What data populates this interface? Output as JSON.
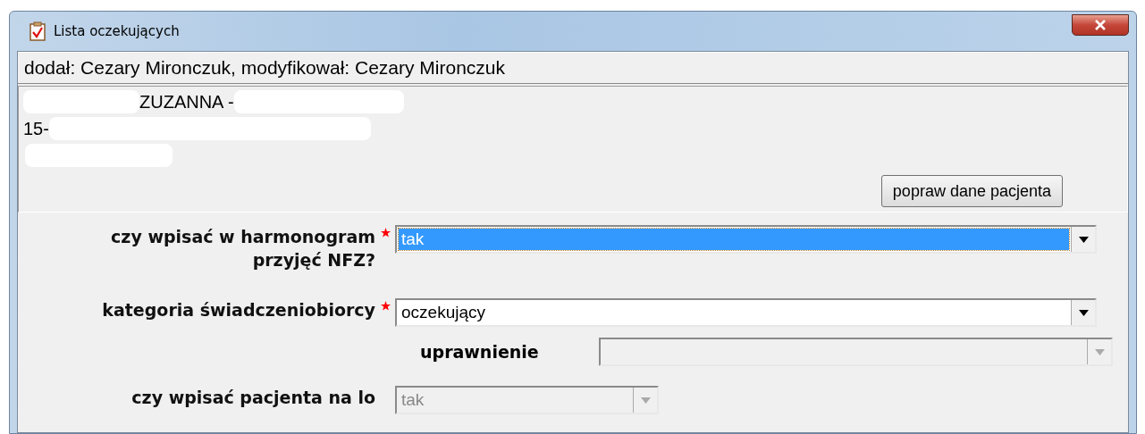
{
  "window": {
    "title": "Lista oczekujących"
  },
  "audit": "dodał: Cezary Mironczuk, modyfikował: Cezary Mironczuk",
  "patient": {
    "lines": [
      "ZUZANNA -",
      "15-"
    ],
    "button": "popraw dane pacjenta"
  },
  "form": [
    {
      "kind": "select",
      "label": "czy wpisać w harmonogram przyjęć NFZ?",
      "required": true,
      "value": "tak",
      "focused": true,
      "disabled": false
    },
    {
      "kind": "select",
      "label": "kategoria świadczeniobiorcy",
      "required": true,
      "value": "oczekujący",
      "focused": false,
      "disabled": false
    },
    {
      "kind": "subselect",
      "label": "uprawnienie",
      "disabled": true
    },
    {
      "kind": "short-select",
      "label": "czy wpisać pacjenta na lo",
      "required": false,
      "value": "tak",
      "focused": false,
      "disabled": true
    }
  ]
}
